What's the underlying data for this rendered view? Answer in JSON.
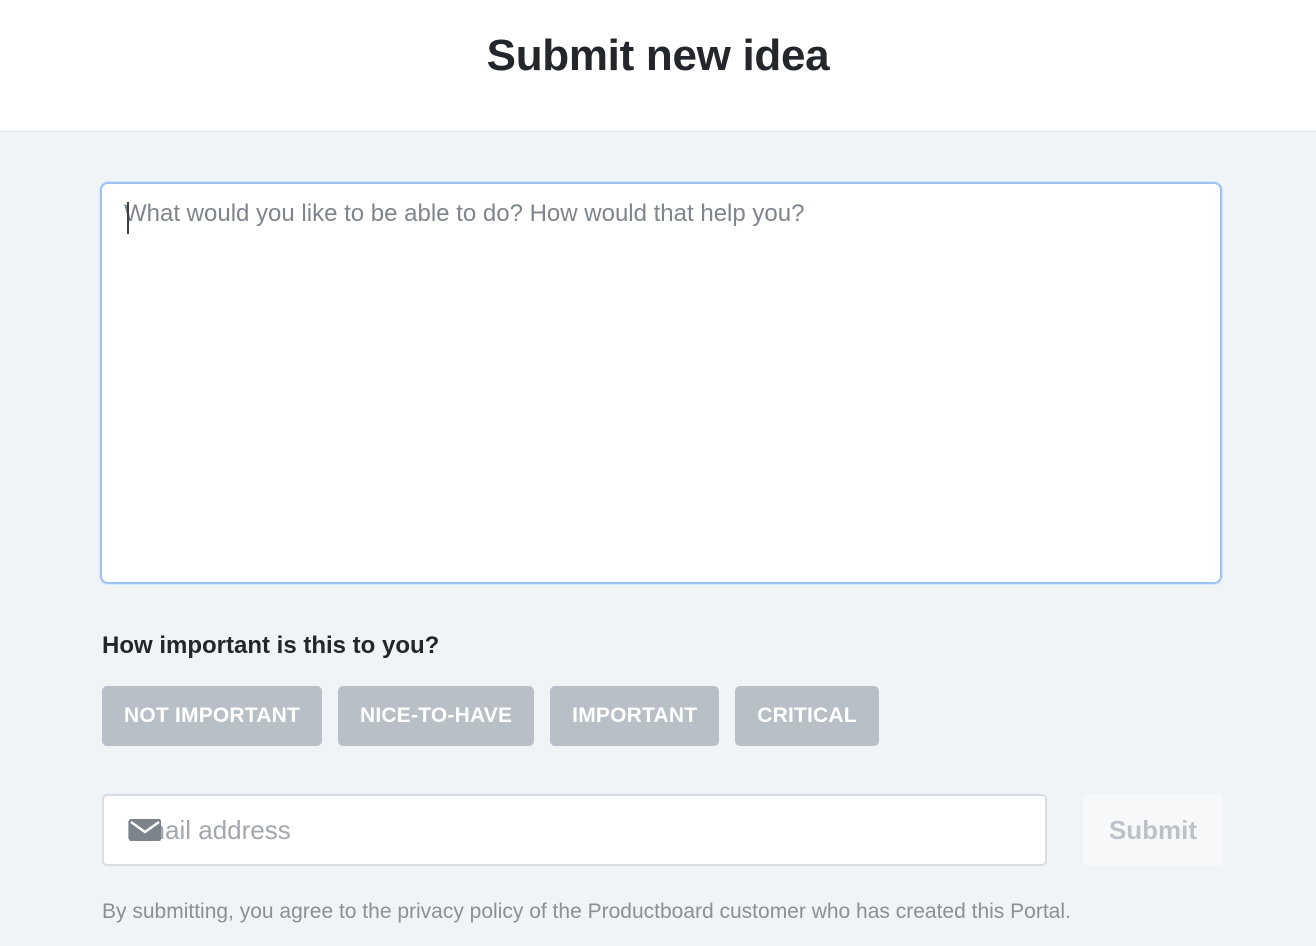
{
  "header": {
    "title": "Submit new idea"
  },
  "idea": {
    "placeholder": "What would you like to be able to do? How would that help you?",
    "value": ""
  },
  "importance": {
    "question": "How important is this to you?",
    "options": [
      {
        "label": "NOT IMPORTANT"
      },
      {
        "label": "NICE-TO-HAVE"
      },
      {
        "label": "IMPORTANT"
      },
      {
        "label": "CRITICAL"
      }
    ],
    "selected": null
  },
  "email": {
    "placeholder": "Email address",
    "icon": "mail-icon",
    "value": ""
  },
  "submit": {
    "label": "Submit",
    "enabled": false
  },
  "footer": {
    "privacy_note": "By submitting, you agree to the privacy policy of the Productboard customer who has created this Portal."
  },
  "colors": {
    "focus_border": "#9ec3f3",
    "chip_bg": "#b9bfc7",
    "background": "#f1f4f6",
    "title_text": "#23262a"
  }
}
